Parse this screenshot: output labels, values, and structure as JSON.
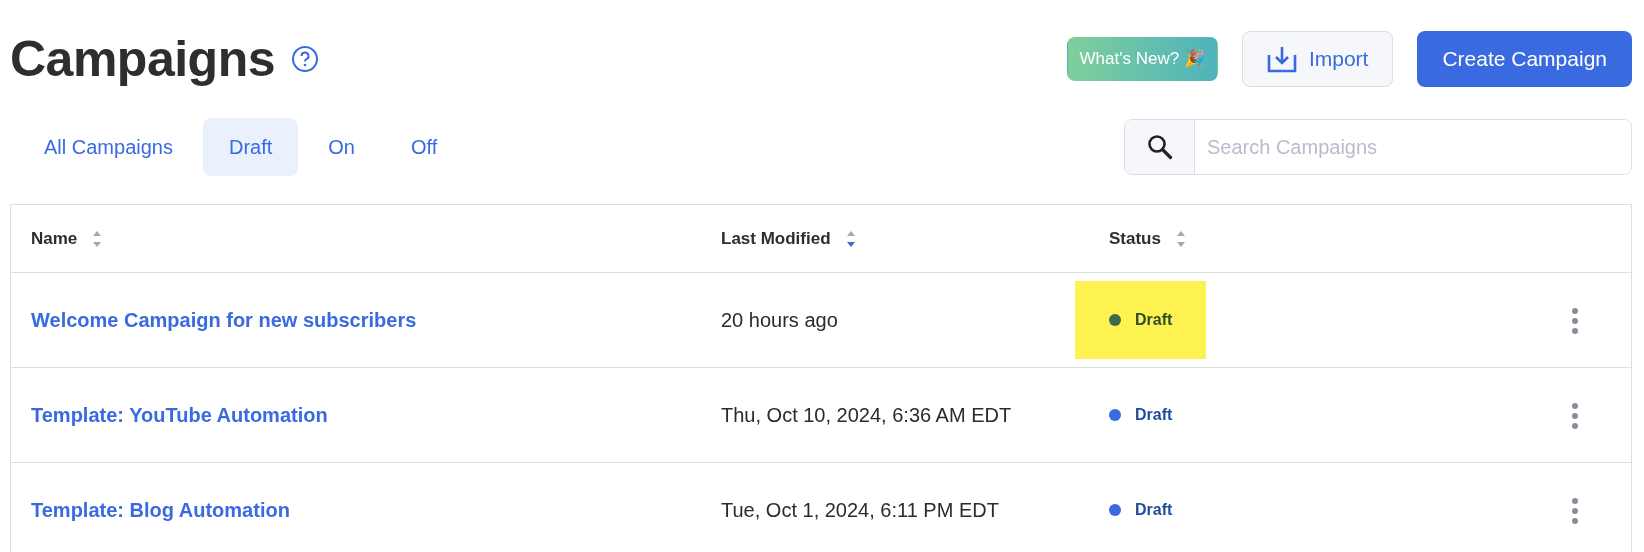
{
  "page": {
    "title": "Campaigns"
  },
  "actions": [
    {
      "kind": "whats-new",
      "label": "What's New? 🎉"
    },
    {
      "kind": "import",
      "label": "Import"
    },
    {
      "kind": "create",
      "label": "Create Campaign"
    }
  ],
  "tabs": [
    {
      "label": "All Campaigns",
      "selected": false
    },
    {
      "label": "Draft",
      "selected": true
    },
    {
      "label": "On",
      "selected": false
    },
    {
      "label": "Off",
      "selected": false
    }
  ],
  "search": {
    "placeholder": "Search Campaigns"
  },
  "table": {
    "columns": [
      {
        "label": "Name",
        "sorted": false
      },
      {
        "label": "Last Modified",
        "sorted": true
      },
      {
        "label": "Status",
        "sorted": false
      }
    ],
    "rows": [
      {
        "name": "Welcome Campaign for new subscribers",
        "modified": "20 hours ago",
        "status": "Draft",
        "color": "#3a6b4a",
        "highlighted": true
      },
      {
        "name": "Template: YouTube Automation",
        "modified": "Thu, Oct 10, 2024, 6:36 AM EDT",
        "status": "Draft",
        "color": "#3a6ae0",
        "highlighted": false
      },
      {
        "name": "Template: Blog Automation",
        "modified": "Tue, Oct 1, 2024, 6:11 PM EDT",
        "status": "Draft",
        "color": "#3a6ae0",
        "highlighted": false
      }
    ]
  }
}
